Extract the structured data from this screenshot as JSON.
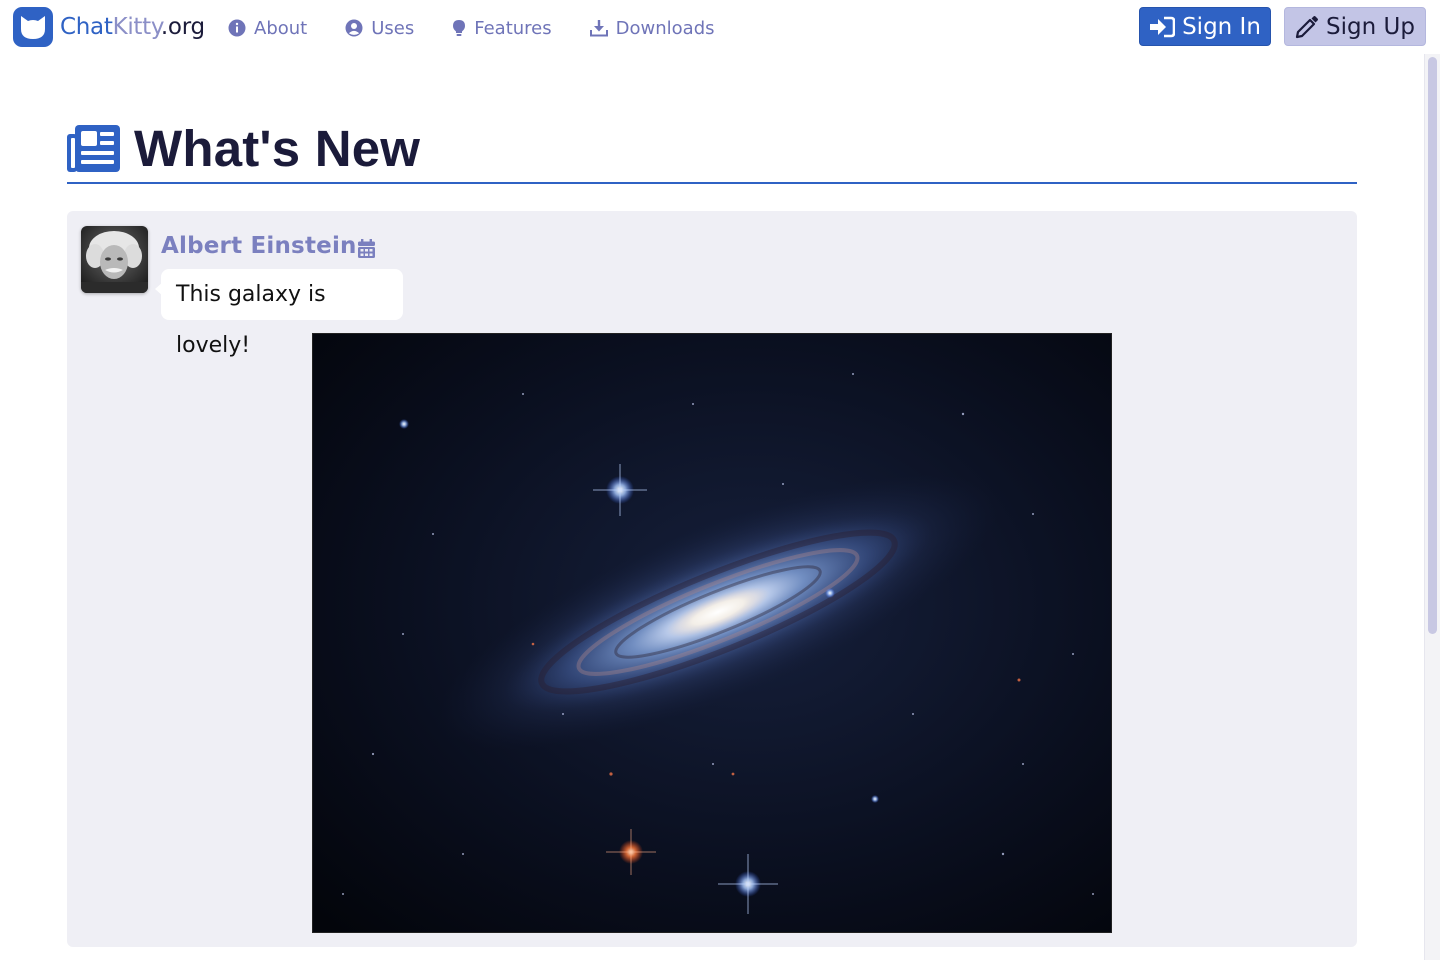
{
  "brand": {
    "part1": "Chat",
    "part2": "Kitty",
    "part3": ".org"
  },
  "nav": {
    "items": [
      {
        "label": "About",
        "icon": "info-circle-icon"
      },
      {
        "label": "Uses",
        "icon": "user-circle-icon"
      },
      {
        "label": "Features",
        "icon": "lightbulb-icon"
      },
      {
        "label": "Downloads",
        "icon": "download-icon"
      }
    ]
  },
  "auth": {
    "signin_label": "Sign In",
    "signin_icon": "sign-in-icon",
    "signup_label": "Sign Up",
    "signup_icon": "pencil-icon"
  },
  "page": {
    "title": "What's New",
    "title_icon": "newspaper-icon"
  },
  "post": {
    "author": "Albert Einstein",
    "date_icon": "calendar-icon",
    "message": "This galaxy is lovely!",
    "image_subject": "spiral galaxy"
  },
  "colors": {
    "accent": "#2f62c4",
    "nav_text": "#6f74b8",
    "secondary_button": "#c3c5e6",
    "card_background": "#efeff5",
    "author_text": "#7b80bf"
  }
}
